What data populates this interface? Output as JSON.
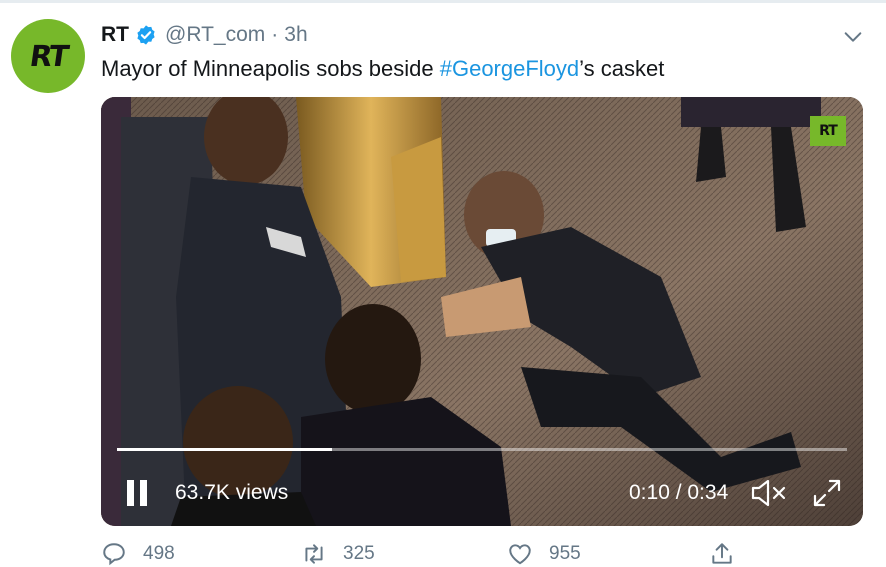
{
  "tweet": {
    "avatar_text": "RT",
    "display_name": "RT",
    "handle": "@RT_com",
    "separator": "·",
    "time": "3h",
    "text_before": "Mayor of Minneapolis sobs beside ",
    "hashtag": "#GeorgeFloyd",
    "text_after": "’s casket",
    "icons": {
      "verified": "verified-badge-icon",
      "more": "chevron-down-icon"
    }
  },
  "video": {
    "watermark": "RT",
    "views": "63.7K views",
    "duration": "0:10 / 0:34",
    "progress": 0.294,
    "icons": {
      "pause": "pause-icon",
      "mute": "muted-speaker-icon",
      "fullscreen": "fullscreen-icon"
    }
  },
  "actions": {
    "reply_count": "498",
    "retweet_count": "325",
    "like_count": "955",
    "icons": [
      "reply-icon",
      "retweet-icon",
      "like-icon",
      "share-icon"
    ]
  },
  "colors": {
    "brand_green": "#77b82a",
    "link_blue": "#1b95e0",
    "secondary_text": "#657786",
    "primary_text": "#14171a"
  }
}
